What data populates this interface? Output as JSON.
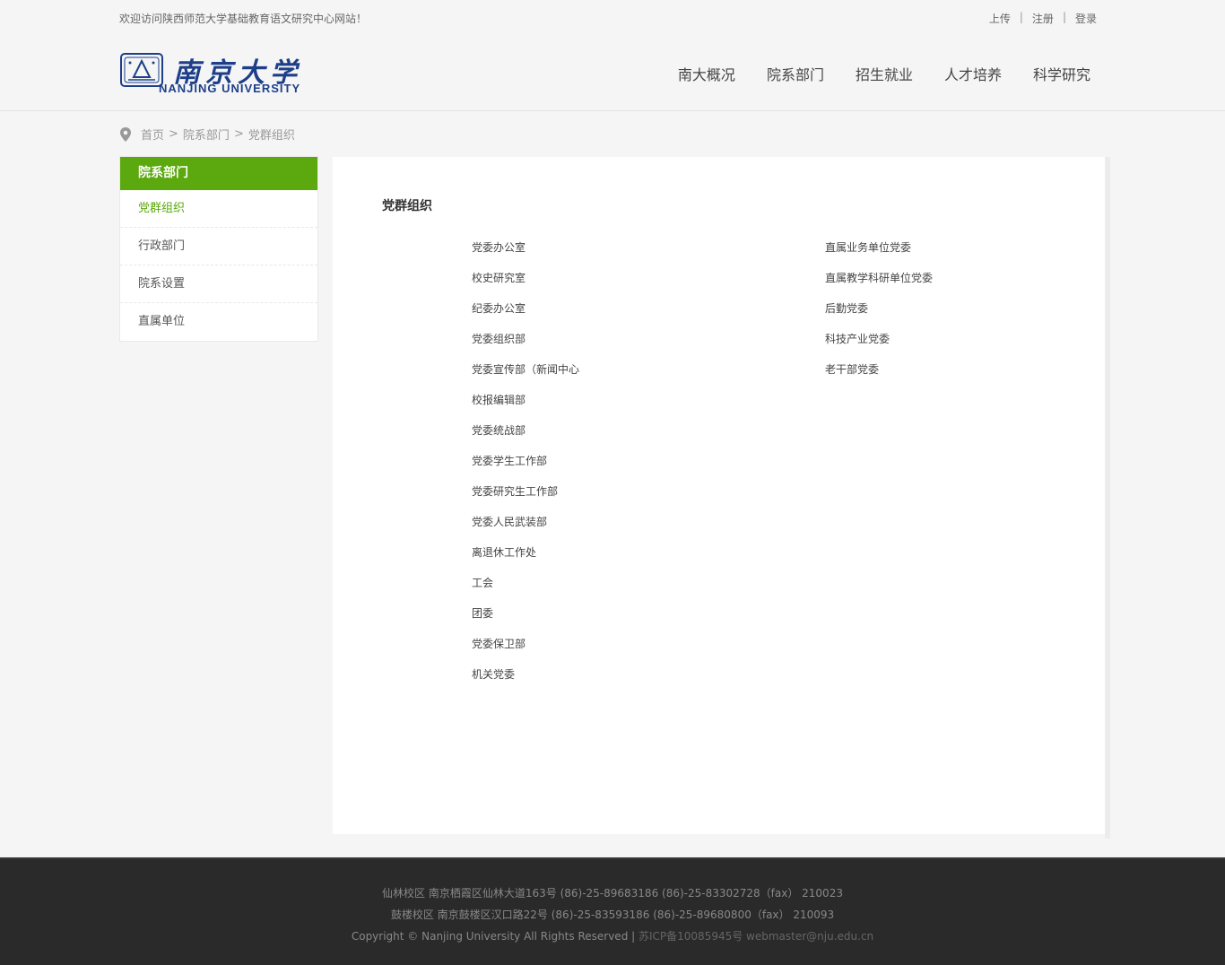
{
  "topbar": {
    "welcome": "欢迎访问陕西师范大学基础教育语文研究中心网站！",
    "links": [
      "上传",
      "注册",
      "登录"
    ],
    "separator": "|"
  },
  "logo": {
    "cn": "南京大学",
    "en": "NANJING UNIVERSITY"
  },
  "nav": [
    "南大概况",
    "院系部门",
    "招生就业",
    "人才培养",
    "科学研究"
  ],
  "breadcrumb": {
    "items": [
      "首页",
      "院系部门",
      "党群组织"
    ],
    "arrow": ">"
  },
  "sidebar": {
    "title": "院系部门",
    "items": [
      "党群组织",
      "行政部门",
      "院系设置",
      "直属单位"
    ],
    "active_index": 0
  },
  "content": {
    "title": "党群组织",
    "left_col": [
      "党委办公室",
      "校史研究室",
      "纪委办公室",
      "党委组织部",
      "党委宣传部（新闻中心",
      "校报编辑部",
      "党委统战部",
      "党委学生工作部",
      "党委研究生工作部",
      "党委人民武装部",
      "离退休工作处",
      "工会",
      "团委",
      "党委保卫部",
      "机关党委"
    ],
    "right_col": [
      "直属业务单位党委",
      "直属教学科研单位党委",
      "后勤党委",
      "科技产业党委",
      "老干部党委"
    ]
  },
  "footer": {
    "line1": "仙林校区 南京栖霞区仙林大道163号 (86)-25-89683186 (86)-25-83302728（fax） 210023",
    "line2": "鼓楼校区 南京鼓楼区汉口路22号 (86)-25-83593186 (86)-25-89680800（fax） 210093",
    "line3_a": "Copyright © Nanjing University All Rights Reserved | ",
    "line3_b": "苏ICP备10085945号",
    "line3_c": " webmaster@nju.edu.cn"
  },
  "colors": {
    "accent": "#5ba90f",
    "logo_blue": "#1d3f8a",
    "footer_bg": "#2a2a2a"
  },
  "icons": [
    "location-pin-icon",
    "university-emblem-icon"
  ]
}
